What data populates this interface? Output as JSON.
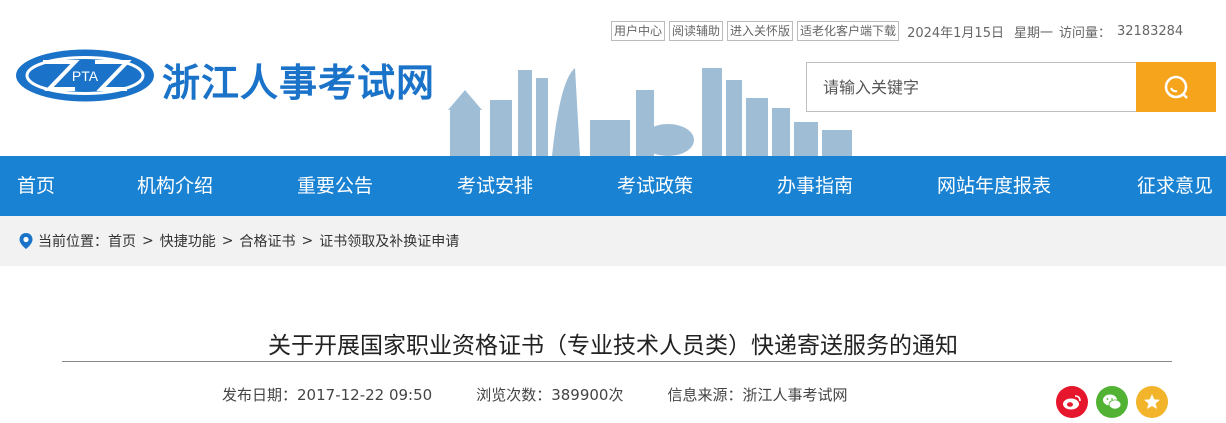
{
  "header": {
    "site_name": "浙江人事考试网",
    "logo_text": "PTA",
    "util_links": [
      "用户中心",
      "阅读辅助",
      "进入关怀版",
      "适老化客户端下载"
    ],
    "date": "2024年1月15日",
    "weekday": "星期一",
    "visits_label": "访问量：",
    "visits_value": "32183284",
    "search_placeholder": "请输入关键字"
  },
  "nav": {
    "items": [
      "首页",
      "机构介绍",
      "重要公告",
      "考试安排",
      "考试政策",
      "办事指南",
      "网站年度报表",
      "征求意见"
    ]
  },
  "breadcrumb": {
    "label": "当前位置：",
    "items": [
      "首页",
      "快捷功能",
      "合格证书",
      "证书领取及补换证申请"
    ],
    "separator": ">"
  },
  "article": {
    "title": "关于开展国家职业资格证书（专业技术人员类）快递寄送服务的通知",
    "publish_label": "发布日期：",
    "publish_value": "2017-12-22 09:50",
    "views_label": "浏览次数：",
    "views_value": "389900次",
    "source_label": "信息来源：",
    "source_value": "浙江人事考试网"
  },
  "share": [
    "weibo-icon",
    "wechat-icon",
    "favorite-icon"
  ],
  "colors": {
    "nav_bg": "#1a82d2",
    "brand_blue": "#1a73c9",
    "search_btn": "#f5a41c",
    "weibo": "#e6162d",
    "wechat": "#51b233",
    "favorite": "#f2b42a"
  }
}
